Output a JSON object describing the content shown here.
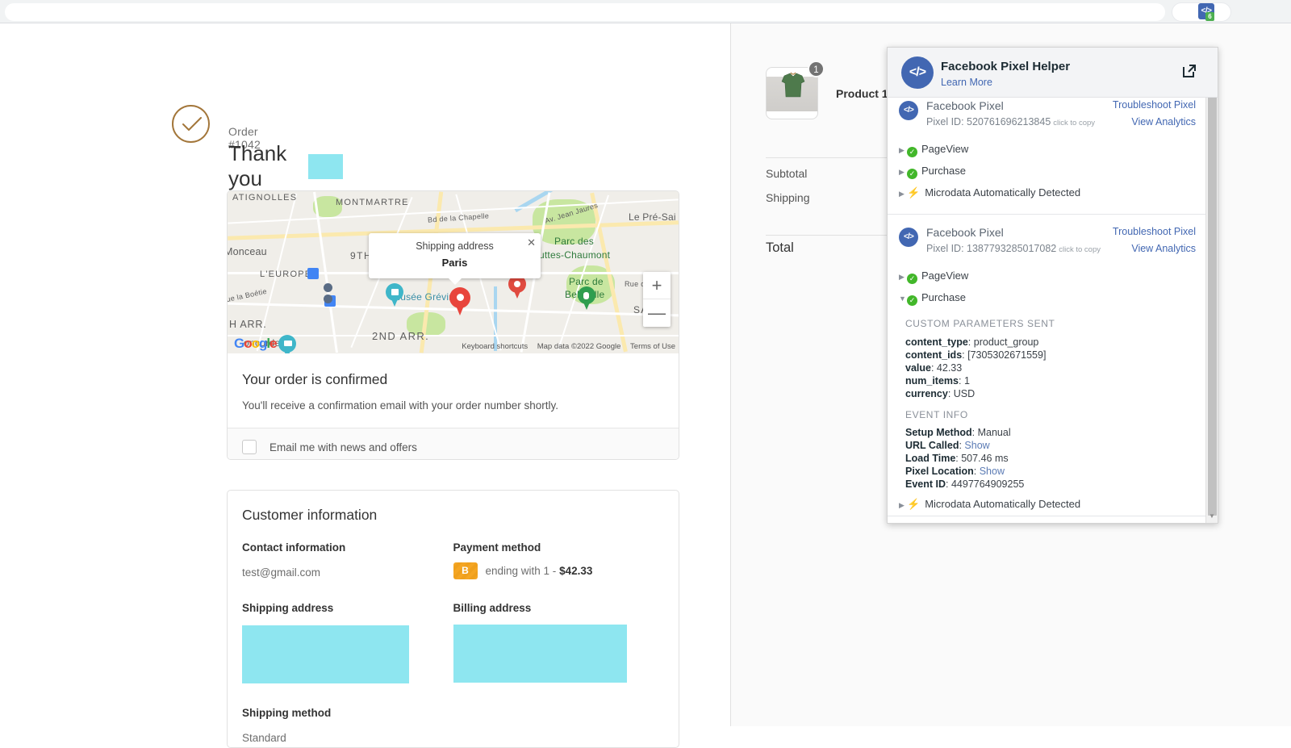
{
  "browser": {
    "omnibox_value": "",
    "extension": {
      "icon": "code-brackets-icon",
      "glyph": "</>",
      "badge_count": "6"
    }
  },
  "order": {
    "order_number": "Order #1042",
    "thank_you": "Thank you",
    "customer_name_redacted": "",
    "check_icon": "check-circle-icon"
  },
  "map": {
    "info_title": "Shipping address",
    "info_value": "Paris",
    "close_icon": "close-icon",
    "zoom_in": "+",
    "zoom_out": "—",
    "labels": {
      "batignolles": "ATIGNOLLES",
      "montmartre": "MONTMARTRE",
      "bd_chapelle": "Bd de la Chapelle",
      "av_jean_jaures": "Av. Jean Jaures",
      "le_pre_saint": "Le Pré-Sai",
      "monceau": "Monceau",
      "ninth": "9TH",
      "leurope": "L'EUROPE",
      "rue_la_boetie": "ue la Boétie",
      "h_arr": "H ARR.",
      "concorde": "oncorde",
      "second_arr": "2ND ARR.",
      "musee_grevin": "Musée Grévin",
      "parc_des_buttes": "Parc des",
      "buttes_chaumont": "uttes-Chaumont",
      "parc_de": "Parc de",
      "belleville": "Belleville",
      "rue_de": "Rue de",
      "sa": "SA"
    },
    "credits": {
      "keyboard_shortcuts": "Keyboard shortcuts",
      "map_data": "Map data ©2022 Google",
      "terms": "Terms of Use"
    },
    "logo_letters": [
      "G",
      "o",
      "o",
      "g",
      "l",
      "e"
    ]
  },
  "confirmation": {
    "title": "Your order is confirmed",
    "subtitle": "You'll receive a confirmation email with your order number shortly.",
    "newsletter_label": "Email me with news and offers",
    "newsletter_checked": false
  },
  "customer_information": {
    "title": "Customer information",
    "contact_label": "Contact information",
    "contact_value": "test@gmail.com",
    "payment_label": "Payment method",
    "payment_badge": "B",
    "payment_value_prefix": "ending with 1 - ",
    "payment_amount": "$42.33",
    "shipping_address_label": "Shipping address",
    "shipping_address_value_redacted": "",
    "billing_address_label": "Billing address",
    "billing_address_value_redacted": "",
    "shipping_method_label": "Shipping method",
    "shipping_method_value": "Standard"
  },
  "order_summary": {
    "product_name": "Product 1",
    "quantity_badge": "1",
    "thumbnail": "green-tshirt-image",
    "subtotal_label": "Subtotal",
    "shipping_label": "Shipping",
    "total_label": "Total"
  },
  "pixel_helper": {
    "title": "Facebook Pixel Helper",
    "learn_more": "Learn More",
    "open_icon": "open-in-new-icon",
    "logo_glyph": "</>",
    "pixels": [
      {
        "name": "Facebook Pixel",
        "pixel_id_label": "Pixel ID: 520761696213845",
        "copy_hint": "click to copy",
        "troubleshoot": "Troubleshoot Pixel",
        "analytics": "View Analytics",
        "events": [
          {
            "label": "PageView",
            "status": "ok",
            "expanded": false
          },
          {
            "label": "Purchase",
            "status": "ok",
            "expanded": false
          },
          {
            "label": "Microdata Automatically Detected",
            "status": "bolt",
            "expanded": false
          }
        ]
      },
      {
        "name": "Facebook Pixel",
        "pixel_id_label": "Pixel ID: 1387793285017082",
        "copy_hint": "click to copy",
        "troubleshoot": "Troubleshoot Pixel",
        "analytics": "View Analytics",
        "events": [
          {
            "label": "PageView",
            "status": "ok",
            "expanded": false
          },
          {
            "label": "Purchase",
            "status": "ok",
            "expanded": true
          },
          {
            "label": "Microdata Automatically Detected",
            "status": "bolt",
            "expanded": false
          }
        ],
        "custom_parameters_heading": "CUSTOM PARAMETERS SENT",
        "custom_parameters": [
          {
            "key": "content_type",
            "value": "product_group"
          },
          {
            "key": "content_ids",
            "value": "[7305302671559]"
          },
          {
            "key": "value",
            "value": "42.33"
          },
          {
            "key": "num_items",
            "value": "1"
          },
          {
            "key": "currency",
            "value": "USD"
          }
        ],
        "event_info_heading": "EVENT INFO",
        "event_info": [
          {
            "key": "Setup Method",
            "value": "Manual",
            "link": false
          },
          {
            "key": "URL Called",
            "value": "Show",
            "link": true
          },
          {
            "key": "Load Time",
            "value": "507.46 ms",
            "link": false
          },
          {
            "key": "Pixel Location",
            "value": "Show",
            "link": true
          },
          {
            "key": "Event ID",
            "value": "4497764909255",
            "link": false
          }
        ]
      }
    ]
  },
  "colors": {
    "accent_brown": "#a3763a",
    "fb_blue": "#4267b2",
    "ok_green": "#42b72a",
    "redact_cyan": "#8ee6f0",
    "payment_orange": "#f5a623",
    "badge_green": "#4caf50"
  }
}
